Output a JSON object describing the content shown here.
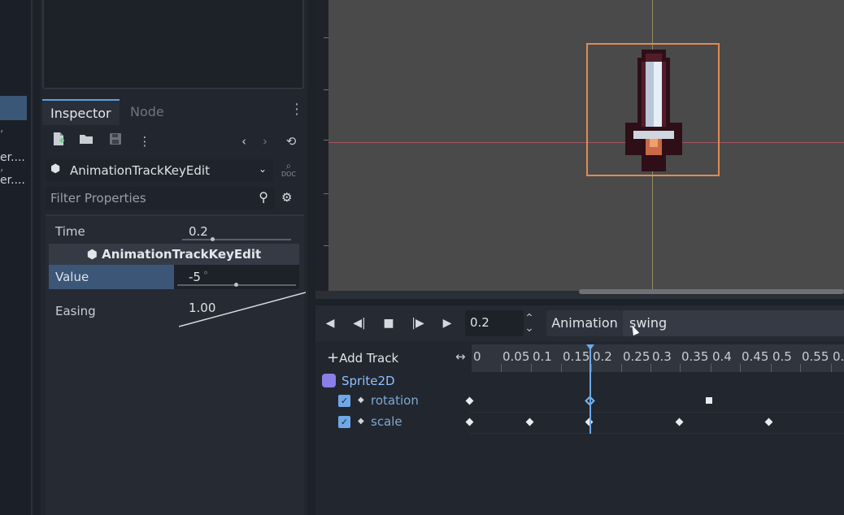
{
  "left_strip": {
    "items": [
      "er....",
      "er...."
    ],
    "marks": [
      ",",
      ","
    ]
  },
  "inspector": {
    "tabs": [
      "Inspector",
      "Node"
    ],
    "toolbar_icons": [
      "new-resource-icon",
      "open-folder-icon",
      "save-icon",
      "more-icon",
      "history-back-icon",
      "history-forward-icon",
      "object-history-icon"
    ],
    "object_name": "AnimationTrackKeyEdit",
    "doc_label": "DOC",
    "filter_placeholder": "Filter Properties",
    "properties": {
      "time_label": "Time",
      "time_value": "0.2",
      "section_title": "AnimationTrackKeyEdit",
      "value_label": "Value",
      "value_value": "-5",
      "value_unit": "°",
      "easing_label": "Easing",
      "easing_value": "1.00"
    }
  },
  "animation": {
    "time": "0.2",
    "animation_button": "Animation",
    "animation_name": "swing",
    "add_track_label": "Add Track",
    "timeline_ticks": [
      "0",
      "0.05",
      "0.1",
      "0.15",
      "0.2",
      "0.25",
      "0.3",
      "0.35",
      "0.4",
      "0.45",
      "0.5",
      "0.55",
      "0."
    ],
    "node_name": "Sprite2D",
    "tracks": [
      {
        "name": "rotation",
        "enabled": true,
        "keys": [
          0,
          0.2,
          0.4
        ],
        "key_shapes": [
          "diamond",
          "diamond-selected",
          "square"
        ]
      },
      {
        "name": "scale",
        "enabled": true,
        "keys": [
          0,
          0.1,
          0.2,
          0.35,
          0.5
        ],
        "key_shapes": [
          "diamond",
          "diamond",
          "diamond",
          "diamond",
          "diamond"
        ]
      }
    ],
    "current_time_value": 0.2
  },
  "colors": {
    "accent_blue": "#5a9fe0",
    "selection_orange": "#e08a54",
    "track_label": "#7fa8d4"
  }
}
